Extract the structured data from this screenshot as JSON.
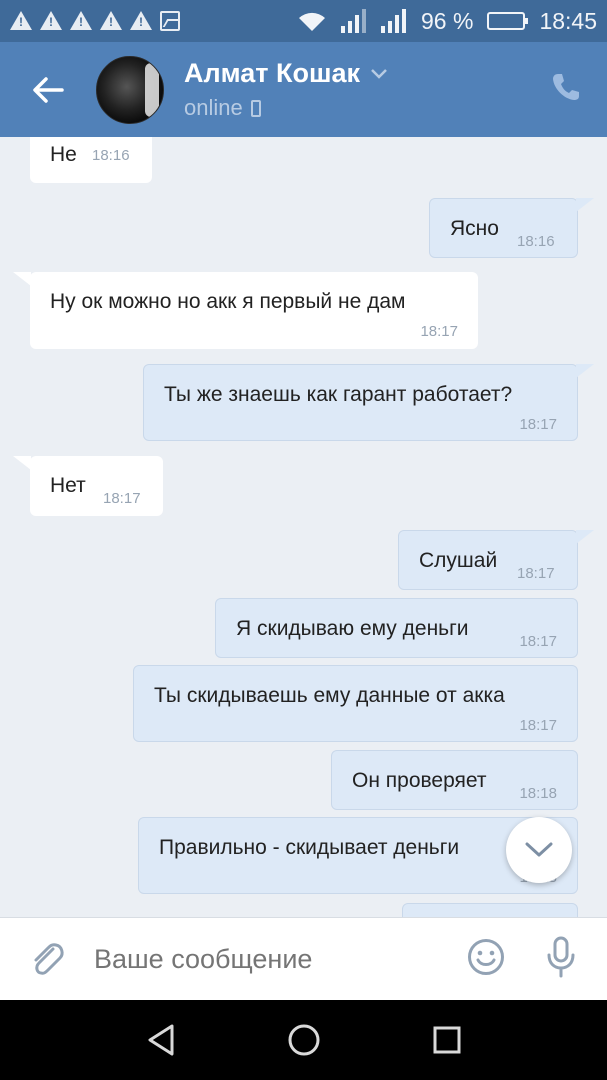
{
  "status_bar": {
    "signal_percent": "96 %",
    "time": "18:45",
    "icons": [
      "warning-icon",
      "warning-icon",
      "warning-icon",
      "warning-icon",
      "warning-icon",
      "image-icon",
      "wifi-icon",
      "signal-icon",
      "signal-icon",
      "battery-icon"
    ],
    "battery_level": 0.96
  },
  "header": {
    "name": "Алмат Кошак",
    "status": "online"
  },
  "messages": [
    {
      "dir": "in",
      "text": "Не",
      "time": "18:16"
    },
    {
      "dir": "out",
      "text": "Ясно",
      "time": "18:16"
    },
    {
      "dir": "in",
      "text": "Ну ок можно но акк я первый не дам",
      "time": "18:17"
    },
    {
      "dir": "out",
      "text": "Ты же знаешь как гарант работает?",
      "time": "18:17"
    },
    {
      "dir": "in",
      "text": "Нет",
      "time": "18:17"
    },
    {
      "dir": "out",
      "text": "Слушай",
      "time": "18:17"
    },
    {
      "dir": "out",
      "text": "Я скидываю ему деньги",
      "time": "18:17"
    },
    {
      "dir": "out",
      "text": "Ты скидываешь ему данные от акка",
      "time": "18:17"
    },
    {
      "dir": "out",
      "text": "Он проверяет",
      "time": "18:18"
    },
    {
      "dir": "out",
      "text": "Правильно - скидывает деньги",
      "time": "18:18"
    }
  ],
  "composer": {
    "placeholder": "Ваше сообщение"
  },
  "colors": {
    "header": "#5181b8",
    "status_bar": "#3f6a99",
    "chat_bg": "#ebeff4",
    "outgoing_bubble": "#dde9f7",
    "incoming_bubble": "#ffffff"
  }
}
